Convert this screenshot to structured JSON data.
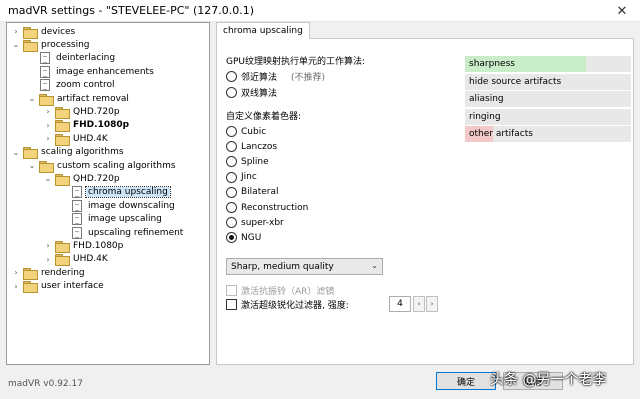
{
  "window": {
    "title": "madVR settings - \"STEVELEE-PC\" (127.0.0.1)",
    "close_glyph": "✕"
  },
  "tree": {
    "items": [
      {
        "label": "devices",
        "expander": "›",
        "icon": "folder-icon"
      },
      {
        "label": "processing",
        "expander": "⌄",
        "icon": "folder-icon"
      },
      {
        "label": "deinterlacing",
        "expander": "",
        "icon": "page-icon"
      },
      {
        "label": "image enhancements",
        "expander": "",
        "icon": "page-icon"
      },
      {
        "label": "zoom control",
        "expander": "",
        "icon": "page-icon"
      },
      {
        "label": "artifact removal",
        "expander": "⌄",
        "icon": "folder-icon"
      },
      {
        "label": "QHD.720p",
        "expander": "›",
        "icon": "folder-icon"
      },
      {
        "label": "FHD.1080p",
        "expander": "›",
        "icon": "folder-icon",
        "bold": true
      },
      {
        "label": "UHD.4K",
        "expander": "›",
        "icon": "folder-icon"
      },
      {
        "label": "scaling algorithms",
        "expander": "⌄",
        "icon": "folder-icon"
      },
      {
        "label": "custom scaling algorithms",
        "expander": "⌄",
        "icon": "folder-icon"
      },
      {
        "label": "QHD.720p",
        "expander": "⌄",
        "icon": "folder-icon"
      },
      {
        "label": "chroma upscaling",
        "expander": "",
        "icon": "page-icon",
        "selected": true
      },
      {
        "label": "image downscaling",
        "expander": "",
        "icon": "page-icon"
      },
      {
        "label": "image upscaling",
        "expander": "",
        "icon": "page-icon"
      },
      {
        "label": "upscaling refinement",
        "expander": "",
        "icon": "page-icon"
      },
      {
        "label": "FHD.1080p",
        "expander": "›",
        "icon": "folder-icon"
      },
      {
        "label": "UHD.4K",
        "expander": "›",
        "icon": "folder-icon"
      },
      {
        "label": "rendering",
        "expander": "›",
        "icon": "folder-icon"
      },
      {
        "label": "user interface",
        "expander": "›",
        "icon": "folder-icon"
      }
    ]
  },
  "tab": {
    "label": "chroma upscaling"
  },
  "gpu_section": {
    "heading": "GPU纹理映射执行单元的工作算法:",
    "options": [
      {
        "label": "邻近算法",
        "note": "(不推荐)",
        "checked": false
      },
      {
        "label": "双线算法",
        "note": "",
        "checked": false
      }
    ]
  },
  "shader_section": {
    "heading": "自定义像素着色器:",
    "options": [
      {
        "label": "Cubic",
        "checked": false
      },
      {
        "label": "Lanczos",
        "checked": false
      },
      {
        "label": "Spline",
        "checked": false
      },
      {
        "label": "Jinc",
        "checked": false
      },
      {
        "label": "Bilateral",
        "checked": false
      },
      {
        "label": "Reconstruction",
        "checked": false
      },
      {
        "label": "super-xbr",
        "checked": false
      },
      {
        "label": "NGU",
        "checked": true
      }
    ]
  },
  "quality_dropdown": {
    "value": "Sharp, medium quality",
    "arrow": "⌄"
  },
  "checkboxes": {
    "anti_ringing": {
      "label": "激活抗振铃（AR）滤镜",
      "checked": false,
      "disabled": true
    },
    "super_sharpen": {
      "label": "激活超级锐化过滤器, 强度:",
      "checked": false,
      "disabled": false
    }
  },
  "strength": {
    "value": "4",
    "dec": "‹",
    "inc": "›"
  },
  "legend": [
    {
      "label": "sharpness",
      "level": 0.73,
      "color": "#c9ecc9"
    },
    {
      "label": "hide source artifacts",
      "level": 0,
      "color": "#c9ecc9"
    },
    {
      "label": "aliasing",
      "level": 0,
      "color": "#c9ecc9"
    },
    {
      "label": "ringing",
      "level": 0,
      "color": "#c9ecc9"
    },
    {
      "label": "other artifacts",
      "level": 0.17,
      "color": "#f2c8c8"
    }
  ],
  "footer": {
    "version": "madVR v0.92.17",
    "ok_label": "确定",
    "cancel_label": "取消"
  },
  "watermark": {
    "text": "头条 @另一个老李"
  }
}
